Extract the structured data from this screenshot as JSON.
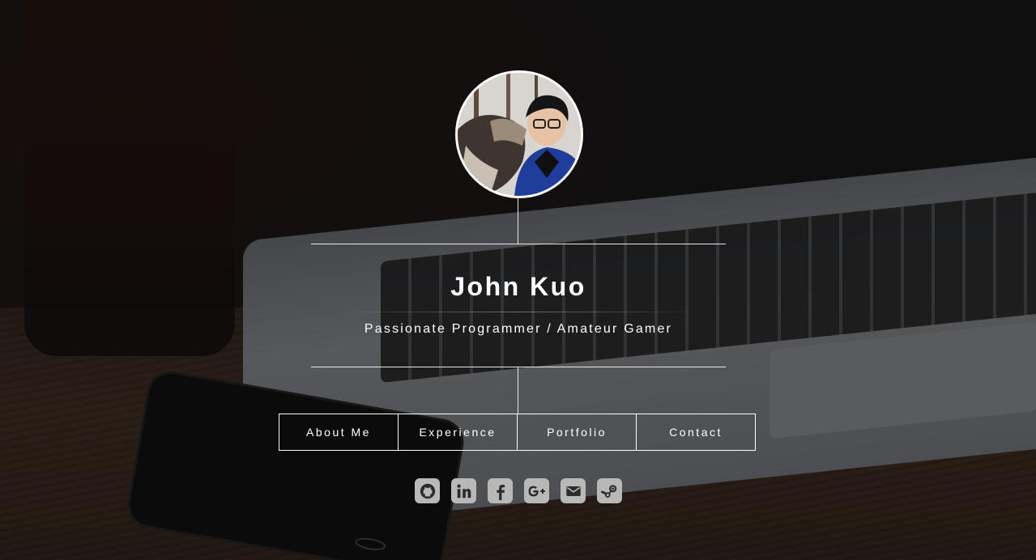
{
  "profile": {
    "name": "John Kuo",
    "tagline": "Passionate Programmer / Amateur Gamer"
  },
  "nav": {
    "items": [
      {
        "label": "About Me"
      },
      {
        "label": "Experience"
      },
      {
        "label": "Portfolio"
      },
      {
        "label": "Contact"
      }
    ]
  },
  "social": {
    "icons": [
      "github-icon",
      "linkedin-icon",
      "facebook-icon",
      "google-plus-icon",
      "email-icon",
      "steam-icon"
    ],
    "icon_color": "#b8b8b8"
  },
  "colors": {
    "text": "#ffffff",
    "lines": "#e8e8e8"
  }
}
